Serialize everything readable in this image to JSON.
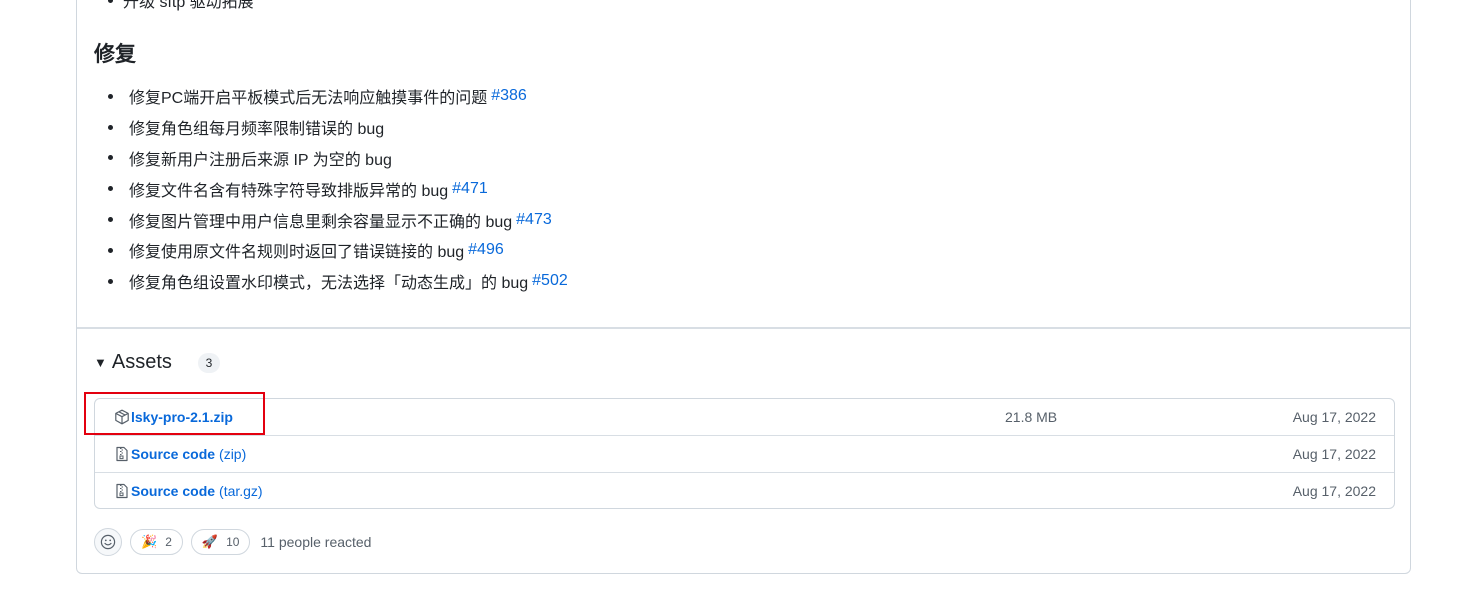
{
  "release_notes": {
    "previous_item": "升级 sftp 驱动拓展",
    "fix_heading": "修复",
    "fixes": [
      {
        "text": "修复PC端开启平板模式后无法响应触摸事件的问题",
        "issue": "#386"
      },
      {
        "text": "修复角色组每月频率限制错误的 bug",
        "issue": ""
      },
      {
        "text": "修复新用户注册后来源 IP 为空的 bug",
        "issue": ""
      },
      {
        "text": "修复文件名含有特殊字符导致排版异常的 bug",
        "issue": "#471"
      },
      {
        "text": "修复图片管理中用户信息里剩余容量显示不正确的 bug",
        "issue": "#473"
      },
      {
        "text": "修复使用原文件名规则时返回了错误链接的 bug",
        "issue": "#496"
      },
      {
        "text": "修复角色组设置水印模式，无法选择「动态生成」的 bug",
        "issue": "#502"
      }
    ]
  },
  "assets": {
    "toggle_icon": "triangle-down",
    "title": "Assets",
    "count": "3",
    "items": [
      {
        "icon": "package-icon",
        "name": "lsky-pro-2.1.zip",
        "suffix": "",
        "size": "21.8 MB",
        "date": "Aug 17, 2022"
      },
      {
        "icon": "file-zip-icon",
        "name": "Source code",
        "suffix": "(zip)",
        "size": "",
        "date": "Aug 17, 2022"
      },
      {
        "icon": "file-zip-icon",
        "name": "Source code",
        "suffix": "(tar.gz)",
        "size": "",
        "date": "Aug 17, 2022"
      }
    ]
  },
  "reactions": {
    "add_icon": "smiley-icon",
    "items": [
      {
        "emoji": "🎉",
        "count": "2"
      },
      {
        "emoji": "🚀",
        "count": "10"
      }
    ],
    "summary": "11 people reacted"
  },
  "colors": {
    "link": "#0969da",
    "highlight_box": "#e3000f",
    "border": "#d0d7de"
  }
}
